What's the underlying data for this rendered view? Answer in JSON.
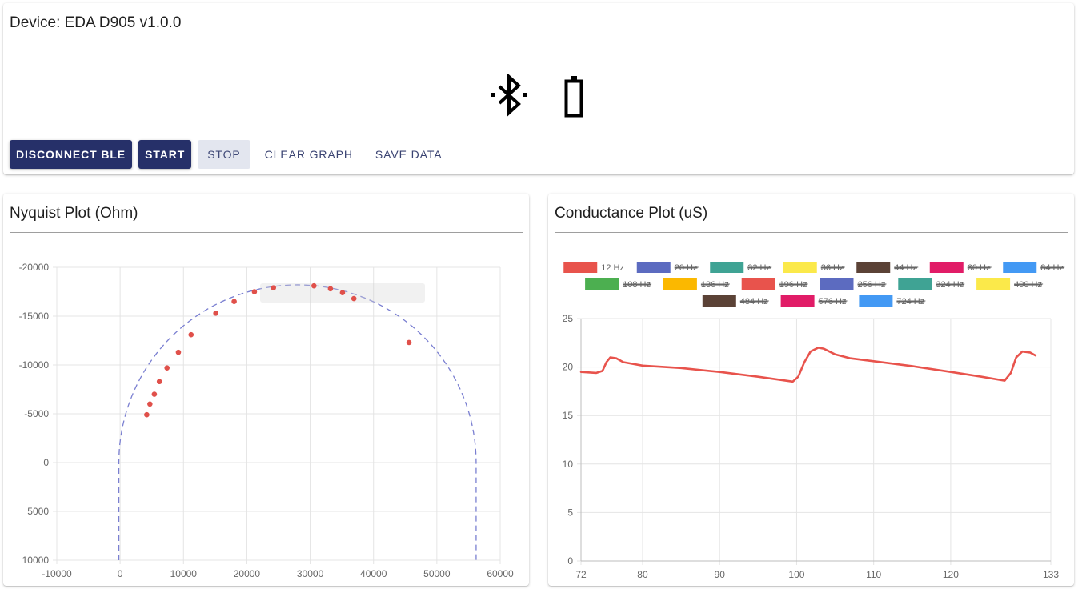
{
  "device": {
    "title": "Device: EDA D905 v1.0.0",
    "icons": [
      "bluetooth-connected-icon",
      "battery-icon"
    ],
    "buttons": {
      "disconnect": "DISCONNECT BLE",
      "start": "START",
      "stop": "STOP",
      "clear": "CLEAR GRAPH",
      "save": "SAVE DATA"
    }
  },
  "nyquist": {
    "title": "Nyquist Plot (Ohm)"
  },
  "conductance": {
    "title": "Conductance Plot (uS)"
  },
  "chart_data": [
    {
      "type": "scatter",
      "title": "",
      "xlabel": "",
      "ylabel": "",
      "xlim": [
        -10000,
        60000
      ],
      "ylim": [
        -20000,
        10000
      ],
      "y_reversed": true,
      "grid": true,
      "x_ticks": [
        "-10000",
        "0",
        "10000",
        "20000",
        "30000",
        "40000",
        "50000",
        "60000"
      ],
      "x_tick_values": [
        -10000,
        0,
        10000,
        20000,
        30000,
        40000,
        50000,
        60000
      ],
      "y_ticks": [
        "-20000",
        "-15000",
        "-10000",
        "-5000",
        "0",
        "5000",
        "10000"
      ],
      "y_tick_values": [
        -20000,
        -15000,
        -10000,
        -5000,
        0,
        5000,
        10000
      ],
      "points": [
        [
          4200,
          -4900
        ],
        [
          4700,
          -6000
        ],
        [
          5400,
          -7000
        ],
        [
          6200,
          -8300
        ],
        [
          7400,
          -9700
        ],
        [
          9200,
          -11300
        ],
        [
          11200,
          -13100
        ],
        [
          15100,
          -15300
        ],
        [
          18000,
          -16500
        ],
        [
          21200,
          -17500
        ],
        [
          24200,
          -17900
        ],
        [
          30600,
          -18100
        ],
        [
          33200,
          -17800
        ],
        [
          35100,
          -17400
        ],
        [
          36900,
          -16800
        ],
        [
          45600,
          -12300
        ]
      ],
      "fit_curve": {
        "center_x": 28000,
        "center_y": 0,
        "radius_x": 28200,
        "radius_y": 18200,
        "x_start": -200,
        "x_end": 56200,
        "y_end": 10000,
        "color": "#7a7fd1"
      },
      "point_color": "#e0504a"
    },
    {
      "type": "line",
      "title": "",
      "xlabel": "",
      "ylabel": "",
      "xlim": [
        72,
        133
      ],
      "ylim": [
        0,
        25
      ],
      "grid": true,
      "x_ticks": [
        "72",
        "80",
        "90",
        "100",
        "110",
        "120",
        "133"
      ],
      "x_tick_values": [
        72,
        80,
        90,
        100,
        110,
        120,
        133
      ],
      "y_ticks": [
        "0",
        "5",
        "10",
        "15",
        "20",
        "25"
      ],
      "y_tick_values": [
        0,
        5,
        10,
        15,
        20,
        25
      ],
      "legend_placement": "top",
      "legend": [
        {
          "name": "12 Hz",
          "color": "#e8534c",
          "hidden": false
        },
        {
          "name": "20 Hz",
          "color": "#5c6bc0",
          "hidden": true
        },
        {
          "name": "32 Hz",
          "color": "#3fa394",
          "hidden": true
        },
        {
          "name": "36 Hz",
          "color": "#fbe94a",
          "hidden": true
        },
        {
          "name": "44 Hz",
          "color": "#5b4236",
          "hidden": true
        },
        {
          "name": "60 Hz",
          "color": "#e11c67",
          "hidden": true
        },
        {
          "name": "84 Hz",
          "color": "#4399f4",
          "hidden": true
        },
        {
          "name": "108 Hz",
          "color": "#4caf50",
          "hidden": true
        },
        {
          "name": "136 Hz",
          "color": "#fbb800",
          "hidden": true
        },
        {
          "name": "196 Hz",
          "color": "#e8534c",
          "hidden": true
        },
        {
          "name": "256 Hz",
          "color": "#5c6bc0",
          "hidden": true
        },
        {
          "name": "324 Hz",
          "color": "#3fa394",
          "hidden": true
        },
        {
          "name": "400 Hz",
          "color": "#fbe94a",
          "hidden": true
        },
        {
          "name": "484 Hz",
          "color": "#5b4236",
          "hidden": true
        },
        {
          "name": "576 Hz",
          "color": "#e11c67",
          "hidden": true
        },
        {
          "name": "724 Hz",
          "color": "#4399f4",
          "hidden": true
        }
      ],
      "series": [
        {
          "name": "12 Hz",
          "color": "#e8534c",
          "points": [
            [
              72,
              19.5
            ],
            [
              74,
              19.4
            ],
            [
              74.8,
              19.6
            ],
            [
              75.3,
              20.5
            ],
            [
              75.8,
              21.0
            ],
            [
              76.6,
              20.9
            ],
            [
              77.5,
              20.5
            ],
            [
              80,
              20.15
            ],
            [
              85,
              19.9
            ],
            [
              90,
              19.5
            ],
            [
              95,
              19.0
            ],
            [
              99.5,
              18.5
            ],
            [
              100.2,
              19.0
            ],
            [
              101,
              20.5
            ],
            [
              101.8,
              21.6
            ],
            [
              102.8,
              22.0
            ],
            [
              103.5,
              21.9
            ],
            [
              105,
              21.3
            ],
            [
              107,
              20.9
            ],
            [
              110,
              20.6
            ],
            [
              115,
              20.1
            ],
            [
              120,
              19.5
            ],
            [
              124,
              19.0
            ],
            [
              127,
              18.6
            ],
            [
              127.8,
              19.4
            ],
            [
              128.5,
              21.0
            ],
            [
              129.3,
              21.6
            ],
            [
              130.3,
              21.5
            ],
            [
              131,
              21.2
            ]
          ]
        }
      ]
    }
  ]
}
